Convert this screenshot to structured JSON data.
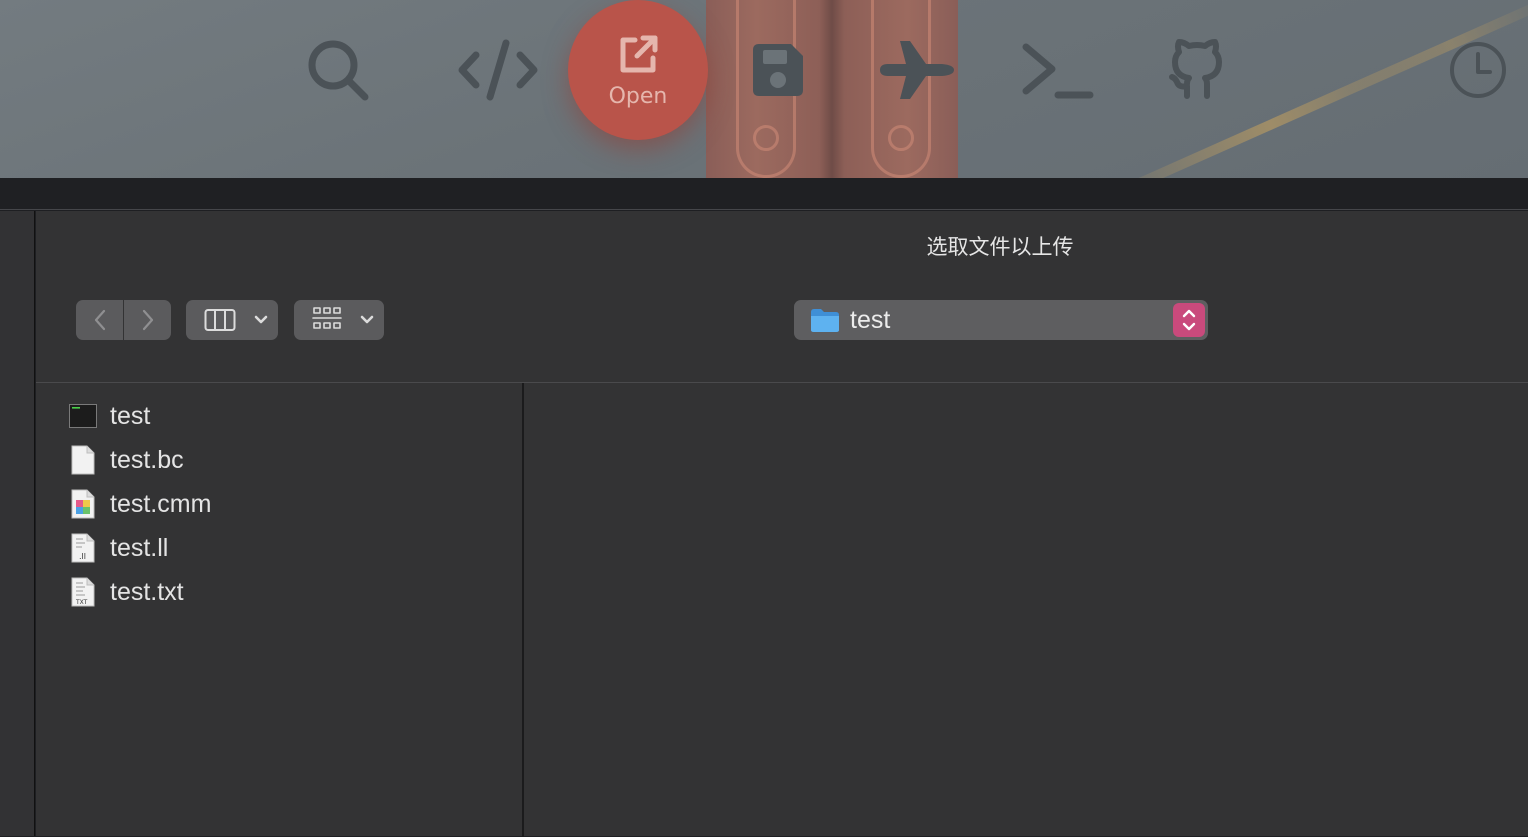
{
  "toolbar": {
    "open_label": "Open",
    "tools": [
      {
        "icon": "search-icon"
      },
      {
        "icon": "code-icon"
      },
      {
        "icon": "open-external-icon"
      },
      {
        "icon": "save-icon"
      },
      {
        "icon": "airplane-icon"
      },
      {
        "icon": "terminal-icon"
      },
      {
        "icon": "github-icon"
      },
      {
        "icon": "clock-icon"
      }
    ]
  },
  "dialog": {
    "title": "选取文件以上传",
    "location": "test",
    "files": [
      {
        "name": "test",
        "icon": "executable-icon"
      },
      {
        "name": "test.bc",
        "icon": "blank-document-icon"
      },
      {
        "name": "test.cmm",
        "icon": "image-document-icon"
      },
      {
        "name": "test.ll",
        "icon": "ll-document-icon"
      },
      {
        "name": "test.txt",
        "icon": "txt-document-icon"
      }
    ]
  },
  "colors": {
    "accent": "#c94a7c",
    "open_button": "#b9544a",
    "sheet_background": "#333334",
    "folder_blue": "#5eb2f0"
  }
}
